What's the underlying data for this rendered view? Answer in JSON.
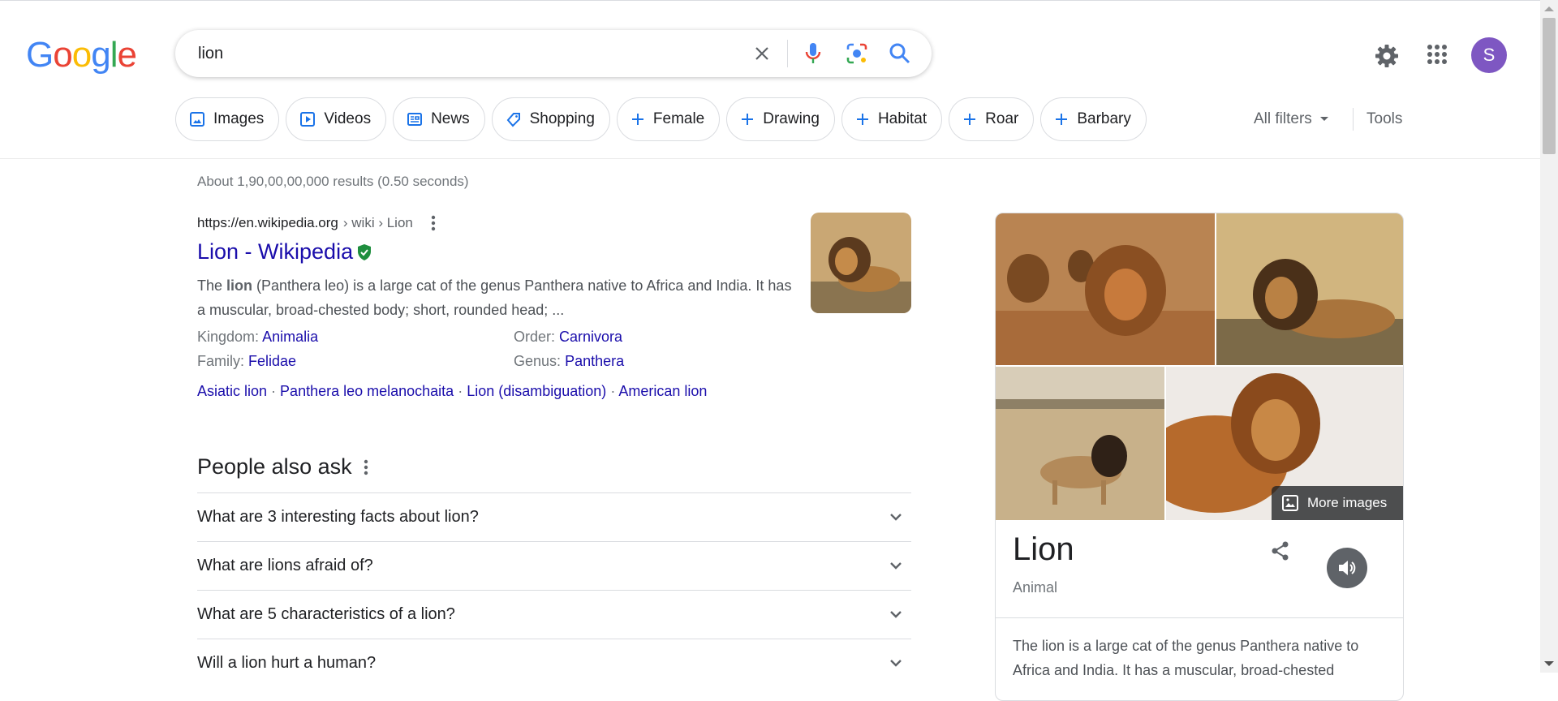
{
  "logo": {
    "letters": [
      "G",
      "o",
      "o",
      "g",
      "l",
      "e"
    ],
    "colors": [
      "#4285f4",
      "#ea4335",
      "#fbbc05",
      "#4285f4",
      "#34a853",
      "#ea4335"
    ]
  },
  "search": {
    "query": "lion"
  },
  "header": {
    "avatar_letter": "S"
  },
  "chips": [
    {
      "label": "Images",
      "icon": "image-icon"
    },
    {
      "label": "Videos",
      "icon": "video-icon"
    },
    {
      "label": "News",
      "icon": "news-icon"
    },
    {
      "label": "Shopping",
      "icon": "tag-icon"
    },
    {
      "label": "Female",
      "icon": "plus-icon"
    },
    {
      "label": "Drawing",
      "icon": "plus-icon"
    },
    {
      "label": "Habitat",
      "icon": "plus-icon"
    },
    {
      "label": "Roar",
      "icon": "plus-icon"
    },
    {
      "label": "Barbary",
      "icon": "plus-icon"
    }
  ],
  "filters": {
    "all_filters": "All filters",
    "tools": "Tools"
  },
  "results": {
    "stats": "About 1,90,00,00,000 results (0.50 seconds)",
    "first": {
      "site": "https://en.wikipedia.org",
      "path": "› wiki › Lion",
      "title": "Lion - Wikipedia",
      "snippet_pre": "The ",
      "snippet_bold": "lion",
      "snippet_post": " (Panthera leo) is a large cat of the genus Panthera native to Africa and India. It has a muscular, broad-chested body; short, rounded head; ...",
      "attributes": [
        {
          "label": "Kingdom:",
          "value": "Animalia"
        },
        {
          "label": "Order:",
          "value": "Carnivora"
        },
        {
          "label": "Family:",
          "value": "Felidae"
        },
        {
          "label": "Genus:",
          "value": "Panthera"
        }
      ],
      "sublinks": [
        "Asiatic lion",
        "Panthera leo melanochaita",
        "Lion (disambiguation)",
        "American lion"
      ],
      "sublink_sep": " · "
    }
  },
  "paa": {
    "title": "People also ask",
    "questions": [
      "What are 3 interesting facts about lion?",
      "What are lions afraid of?",
      "What are 5 characteristics of a lion?",
      "Will a lion hurt a human?"
    ]
  },
  "knowledge_panel": {
    "more_images": "More images",
    "name": "Lion",
    "type": "Animal",
    "description": "The lion is a large cat of the genus Panthera native to Africa and India. It has a muscular, broad-chested"
  }
}
